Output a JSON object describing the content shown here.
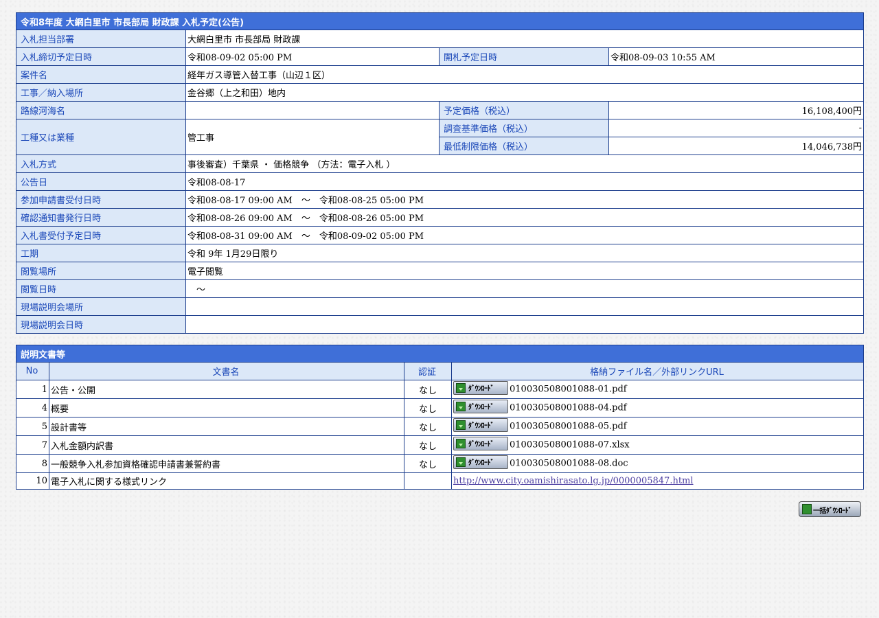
{
  "info": {
    "title": "令和8年度 大網白里市 市長部局 財政課 入札予定(公告)",
    "dept_label": "入札担当部署",
    "dept_value": "大網白里市 市長部局 財政課",
    "deadline_label": "入札締切予定日時",
    "deadline_value": "令和08-09-02 05:00 PM",
    "opening_label": "開札予定日時",
    "opening_value": "令和08-09-03 10:55 AM",
    "project_label": "案件名",
    "project_value": "経年ガス導管入替工事（山辺１区）",
    "location_label": "工事／納入場所",
    "location_value": "金谷郷（上之和田）地内",
    "route_label": "路線河海名",
    "route_value": "",
    "planned_price_label": "予定価格（税込）",
    "planned_price_value": "16,108,400円",
    "type_label": "工種又は業種",
    "type_value": "管工事",
    "survey_price_label": "調査基準価格（税込）",
    "survey_price_value": "-",
    "min_price_label": "最低制限価格（税込）",
    "min_price_value": "14,046,738円",
    "method_label": "入札方式",
    "method_value": "事後審査）千葉県 ・ 価格競争 （方法：電子入札 ）",
    "notice_date_label": "公告日",
    "notice_date_value": "令和08-08-17",
    "application_label": "参加申請書受付日時",
    "application_value": "令和08-08-17 09:00 AM　～　令和08-08-25 05:00 PM",
    "confirm_label": "確認通知書発行日時",
    "confirm_value": "令和08-08-26 09:00 AM　～　令和08-08-26 05:00 PM",
    "bid_receipt_label": "入札書受付予定日時",
    "bid_receipt_value": "令和08-08-31 09:00 AM　～　令和08-09-02 05:00 PM",
    "period_label": "工期",
    "period_value": "令和 9年 1月29日限り",
    "viewing_place_label": "閲覧場所",
    "viewing_place_value": "電子閲覧",
    "viewing_date_label": "閲覧日時",
    "viewing_date_value": "　～",
    "site_place_label": "現場説明会場所",
    "site_place_value": "",
    "site_date_label": "現場説明会日時",
    "site_date_value": ""
  },
  "docs": {
    "title": "説明文書等",
    "headers": {
      "no": "No",
      "name": "文書名",
      "auth": "認証",
      "file": "格納ファイル名／外部リンクURL"
    },
    "download_label": "ﾀﾞｳﾝﾛｰﾄﾞ",
    "rows": [
      {
        "no": "1",
        "name": "公告・公開",
        "auth": "なし",
        "file": "010030508001088-01.pdf"
      },
      {
        "no": "4",
        "name": "概要",
        "auth": "なし",
        "file": "010030508001088-04.pdf"
      },
      {
        "no": "5",
        "name": "設計書等",
        "auth": "なし",
        "file": "010030508001088-05.pdf"
      },
      {
        "no": "7",
        "name": "入札金額内訳書",
        "auth": "なし",
        "file": "010030508001088-07.xlsx"
      },
      {
        "no": "8",
        "name": "一般競争入札参加資格確認申請書兼誓約書",
        "auth": "なし",
        "file": "010030508001088-08.doc"
      }
    ],
    "link_row": {
      "no": "10",
      "name": "電子入札に関する様式リンク",
      "auth": "",
      "url": "http://www.city.oamishirasato.lg.jp/0000005847.html"
    },
    "bulk_download_label": "一括ﾀﾞｳﾝﾛｰﾄﾞ"
  },
  "colors": {
    "header_bg": "#3f6fd8",
    "label_bg": "#dce8f8",
    "label_text": "#1a47b8",
    "border": "#1a3c8c"
  }
}
